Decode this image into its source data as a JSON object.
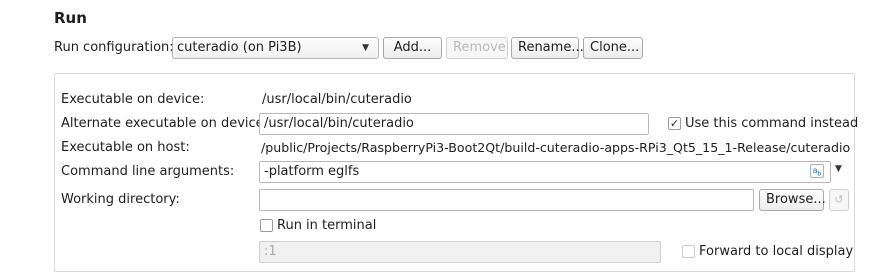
{
  "section": {
    "title": "Run"
  },
  "run_config": {
    "label": "Run configuration:",
    "selected": "cuteradio (on Pi3B)",
    "buttons": {
      "add": "Add...",
      "remove": "Remove",
      "rename": "Rename...",
      "clone": "Clone..."
    }
  },
  "settings": {
    "exec_device": {
      "label": "Executable on device:",
      "value": "/usr/local/bin/cuteradio"
    },
    "alt_exec": {
      "label": "Alternate executable on device:",
      "value": "/usr/local/bin/cuteradio",
      "use_command_label": "Use this command instead",
      "use_command_checked": true
    },
    "exec_host": {
      "label": "Executable on host:",
      "value": "/public/Projects/RaspberryPi3-Boot2Qt/build-cuteradio-apps-RPi3_Qt5_15_1-Release/cuteradio"
    },
    "cmd_args": {
      "label": "Command line arguments:",
      "value": "-platform eglfs"
    },
    "working_dir": {
      "label": "Working directory:",
      "value": "",
      "browse_label": "Browse..."
    },
    "run_in_terminal": {
      "label": "Run in terminal",
      "checked": false
    },
    "display": {
      "value": ":1",
      "forward_label": "Forward to local display",
      "forward_checked": false
    }
  },
  "icons": {
    "check_glyph": "✓",
    "combo_arrow": "▼",
    "variable_icon": "variables-icon",
    "reset_icon": "reset-icon"
  }
}
